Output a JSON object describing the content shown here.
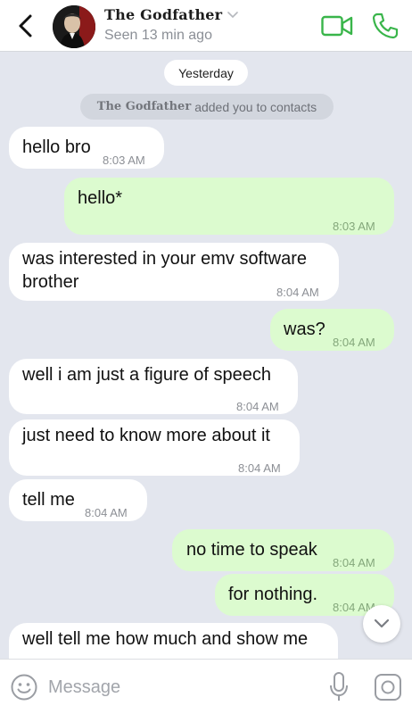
{
  "header": {
    "contact_name": "The Godfather",
    "status": "Seen 13 min ago",
    "icons": {
      "back": "chevron-left-icon",
      "dropdown": "chevron-down-icon",
      "video": "video-camera-icon",
      "call": "phone-icon"
    },
    "accent_color": "#39b54a"
  },
  "chat": {
    "date_label": "Yesterday",
    "system_message": {
      "name": "The Godfather",
      "text": "added you to contacts"
    },
    "messages": [
      {
        "direction": "in",
        "text": "hello bro",
        "time": "8:03 AM"
      },
      {
        "direction": "out",
        "text": "hello*",
        "time": "8:03 AM"
      },
      {
        "direction": "in",
        "text_lines": [
          "was interested in your emv software",
          "brother"
        ],
        "time": "8:04 AM"
      },
      {
        "direction": "out",
        "text": "was?",
        "time": "8:04 AM"
      },
      {
        "direction": "in",
        "text": "well i am just a figure of speech",
        "time": "8:04 AM"
      },
      {
        "direction": "in",
        "text": "just need to know more about it",
        "time": "8:04 AM"
      },
      {
        "direction": "in",
        "text": "tell me",
        "time": "8:04 AM"
      },
      {
        "direction": "out",
        "text": "no time to speak",
        "time": "8:04 AM"
      },
      {
        "direction": "out",
        "text": "for nothing.",
        "time": "8:04 AM"
      },
      {
        "direction": "in",
        "text": "well tell me how much and show me"
      }
    ],
    "colors": {
      "background": "#e3e6ee",
      "incoming_bubble": "#ffffff",
      "outgoing_bubble": "#dcfbcf"
    }
  },
  "composer": {
    "placeholder": "Message",
    "icons": {
      "emoji": "smiley-icon",
      "mic": "microphone-icon",
      "camera": "camera-icon",
      "scroll": "chevron-down-icon"
    }
  }
}
